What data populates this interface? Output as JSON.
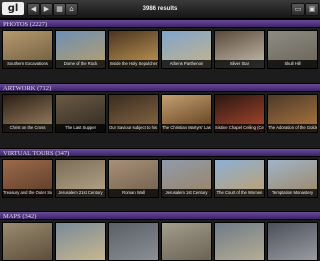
{
  "app": {
    "logo": "gl",
    "results": "3986 results"
  },
  "toolbar_icons": [
    "back-arrow-icon",
    "forward-arrow-icon",
    "grid-icon",
    "home-icon",
    "folder-icon",
    "photo-icon"
  ],
  "sections": [
    {
      "title": "PHOTOS (2227)",
      "items": [
        {
          "label": "Southern Excavations",
          "colors": [
            "#b59a6e",
            "#6d5a3d"
          ]
        },
        {
          "label": "Dome of the Rock",
          "colors": [
            "#6c8fb5",
            "#b9a06a"
          ]
        },
        {
          "label": "Inside the Holy Sepulcher",
          "colors": [
            "#4b3522",
            "#c39a54"
          ]
        },
        {
          "label": "Athens Parthenon",
          "colors": [
            "#7fa5cc",
            "#c7b48a"
          ]
        },
        {
          "label": "Silver Star",
          "colors": [
            "#5a4a3c",
            "#c8c0b0"
          ]
        },
        {
          "label": "Skull Hill",
          "colors": [
            "#8c8c84",
            "#6b6355"
          ]
        }
      ]
    },
    {
      "title": "ARTWORK (712)",
      "items": [
        {
          "label": "Christ on the Cross",
          "colors": [
            "#2b1e14",
            "#9f8665"
          ]
        },
        {
          "label": "The Last Supper",
          "colors": [
            "#6b5a44",
            "#2f2a22"
          ]
        },
        {
          "label": "Our Saviour subject to his Pa...",
          "colors": [
            "#3a2c20",
            "#8a6b45"
          ]
        },
        {
          "label": "The Christian Martyrs' Last ...",
          "colors": [
            "#c4a070",
            "#5c3a1c"
          ]
        },
        {
          "label": "Sistine Chapel Ceiling (Centr...",
          "colors": [
            "#2a1712",
            "#b04a2e"
          ]
        },
        {
          "label": "The Adoration of the Golden...",
          "colors": [
            "#4d3a2a",
            "#b07840"
          ]
        }
      ]
    },
    {
      "title": "VIRTUAL TOURS (347)",
      "items": [
        {
          "label": "Treasury and the Outer Siq",
          "colors": [
            "#9c6a4a",
            "#5a3b28"
          ]
        },
        {
          "label": "Jerusalem 21st Century",
          "colors": [
            "#7a6c58",
            "#b8a78a"
          ]
        },
        {
          "label": "Roman Wall",
          "colors": [
            "#a89078",
            "#6f5e4c"
          ]
        },
        {
          "label": "Jerusalem 1st Century",
          "colors": [
            "#8f9cac",
            "#9c8262"
          ]
        },
        {
          "label": "The Court of the Women",
          "colors": [
            "#8cb0d4",
            "#c1a06c"
          ]
        },
        {
          "label": "Temptation Monastery",
          "colors": [
            "#9fb5c9",
            "#9e8462"
          ]
        }
      ]
    },
    {
      "title": "MAPS (342)",
      "items": [
        {
          "label": "",
          "colors": [
            "#9a8c70",
            "#5c4e3a"
          ]
        },
        {
          "label": "",
          "colors": [
            "#7a8a98",
            "#c7b790"
          ]
        },
        {
          "label": "",
          "colors": [
            "#5a5e66",
            "#8a8f96"
          ]
        },
        {
          "label": "",
          "colors": [
            "#a39e8e",
            "#6b6252"
          ]
        },
        {
          "label": "",
          "colors": [
            "#6e7b86",
            "#b6ad96"
          ]
        },
        {
          "label": "",
          "colors": [
            "#4b4f58",
            "#9a9ca2"
          ]
        }
      ]
    }
  ]
}
